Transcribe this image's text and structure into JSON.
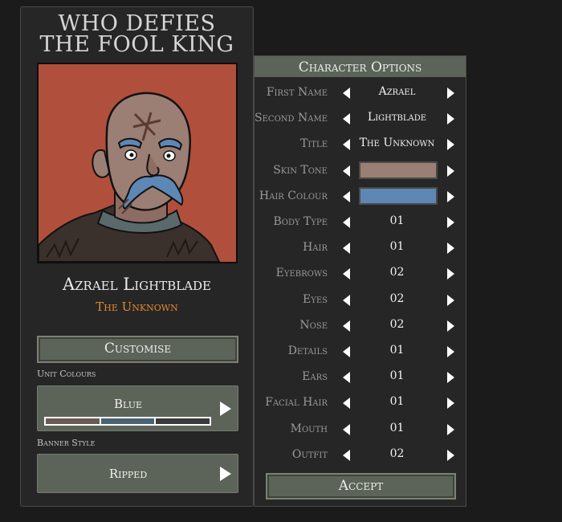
{
  "game_title_line1": "WHO DEFIES",
  "game_title_line2": "THE FOOL KING",
  "character": {
    "name": "Azrael Lightblade",
    "title": "The Unknown"
  },
  "customise_button": "Customise",
  "unit_colours": {
    "label": "Unit Colours",
    "value": "Blue",
    "swatches": [
      "#6b5a55",
      "#4a6272",
      "#3a3a3d"
    ]
  },
  "banner_style": {
    "label": "Banner Style",
    "value": "Ripped"
  },
  "options_panel": {
    "header": "Character Options",
    "accept_button": "Accept",
    "rows": [
      {
        "label": "First Name",
        "value": "Azrael"
      },
      {
        "label": "Second Name",
        "value": "Lightblade"
      },
      {
        "label": "Title",
        "value": "The Unknown"
      },
      {
        "label": "Skin Tone",
        "swatch": "#9b7e74"
      },
      {
        "label": "Hair Colour",
        "swatch": "#5d87b5"
      },
      {
        "label": "Body Type",
        "value": "01"
      },
      {
        "label": "Hair",
        "value": "01"
      },
      {
        "label": "Eyebrows",
        "value": "02"
      },
      {
        "label": "Eyes",
        "value": "02"
      },
      {
        "label": "Nose",
        "value": "02"
      },
      {
        "label": "Details",
        "value": "01"
      },
      {
        "label": "Ears",
        "value": "01"
      },
      {
        "label": "Facial Hair",
        "value": "01"
      },
      {
        "label": "Mouth",
        "value": "01"
      },
      {
        "label": "Outfit",
        "value": "02"
      }
    ]
  }
}
